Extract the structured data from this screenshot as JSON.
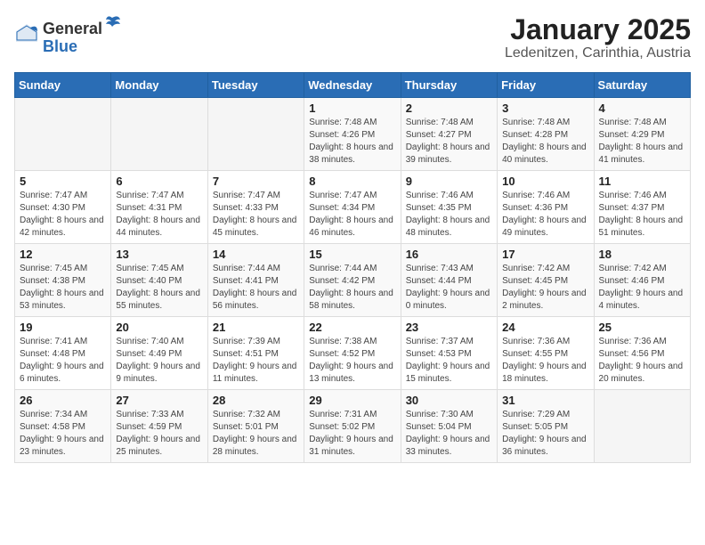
{
  "logo": {
    "general": "General",
    "blue": "Blue"
  },
  "header": {
    "month": "January 2025",
    "location": "Ledenitzen, Carinthia, Austria"
  },
  "weekdays": [
    "Sunday",
    "Monday",
    "Tuesday",
    "Wednesday",
    "Thursday",
    "Friday",
    "Saturday"
  ],
  "weeks": [
    [
      {
        "day": "",
        "info": ""
      },
      {
        "day": "",
        "info": ""
      },
      {
        "day": "",
        "info": ""
      },
      {
        "day": "1",
        "info": "Sunrise: 7:48 AM\nSunset: 4:26 PM\nDaylight: 8 hours and 38 minutes."
      },
      {
        "day": "2",
        "info": "Sunrise: 7:48 AM\nSunset: 4:27 PM\nDaylight: 8 hours and 39 minutes."
      },
      {
        "day": "3",
        "info": "Sunrise: 7:48 AM\nSunset: 4:28 PM\nDaylight: 8 hours and 40 minutes."
      },
      {
        "day": "4",
        "info": "Sunrise: 7:48 AM\nSunset: 4:29 PM\nDaylight: 8 hours and 41 minutes."
      }
    ],
    [
      {
        "day": "5",
        "info": "Sunrise: 7:47 AM\nSunset: 4:30 PM\nDaylight: 8 hours and 42 minutes."
      },
      {
        "day": "6",
        "info": "Sunrise: 7:47 AM\nSunset: 4:31 PM\nDaylight: 8 hours and 44 minutes."
      },
      {
        "day": "7",
        "info": "Sunrise: 7:47 AM\nSunset: 4:33 PM\nDaylight: 8 hours and 45 minutes."
      },
      {
        "day": "8",
        "info": "Sunrise: 7:47 AM\nSunset: 4:34 PM\nDaylight: 8 hours and 46 minutes."
      },
      {
        "day": "9",
        "info": "Sunrise: 7:46 AM\nSunset: 4:35 PM\nDaylight: 8 hours and 48 minutes."
      },
      {
        "day": "10",
        "info": "Sunrise: 7:46 AM\nSunset: 4:36 PM\nDaylight: 8 hours and 49 minutes."
      },
      {
        "day": "11",
        "info": "Sunrise: 7:46 AM\nSunset: 4:37 PM\nDaylight: 8 hours and 51 minutes."
      }
    ],
    [
      {
        "day": "12",
        "info": "Sunrise: 7:45 AM\nSunset: 4:38 PM\nDaylight: 8 hours and 53 minutes."
      },
      {
        "day": "13",
        "info": "Sunrise: 7:45 AM\nSunset: 4:40 PM\nDaylight: 8 hours and 55 minutes."
      },
      {
        "day": "14",
        "info": "Sunrise: 7:44 AM\nSunset: 4:41 PM\nDaylight: 8 hours and 56 minutes."
      },
      {
        "day": "15",
        "info": "Sunrise: 7:44 AM\nSunset: 4:42 PM\nDaylight: 8 hours and 58 minutes."
      },
      {
        "day": "16",
        "info": "Sunrise: 7:43 AM\nSunset: 4:44 PM\nDaylight: 9 hours and 0 minutes."
      },
      {
        "day": "17",
        "info": "Sunrise: 7:42 AM\nSunset: 4:45 PM\nDaylight: 9 hours and 2 minutes."
      },
      {
        "day": "18",
        "info": "Sunrise: 7:42 AM\nSunset: 4:46 PM\nDaylight: 9 hours and 4 minutes."
      }
    ],
    [
      {
        "day": "19",
        "info": "Sunrise: 7:41 AM\nSunset: 4:48 PM\nDaylight: 9 hours and 6 minutes."
      },
      {
        "day": "20",
        "info": "Sunrise: 7:40 AM\nSunset: 4:49 PM\nDaylight: 9 hours and 9 minutes."
      },
      {
        "day": "21",
        "info": "Sunrise: 7:39 AM\nSunset: 4:51 PM\nDaylight: 9 hours and 11 minutes."
      },
      {
        "day": "22",
        "info": "Sunrise: 7:38 AM\nSunset: 4:52 PM\nDaylight: 9 hours and 13 minutes."
      },
      {
        "day": "23",
        "info": "Sunrise: 7:37 AM\nSunset: 4:53 PM\nDaylight: 9 hours and 15 minutes."
      },
      {
        "day": "24",
        "info": "Sunrise: 7:36 AM\nSunset: 4:55 PM\nDaylight: 9 hours and 18 minutes."
      },
      {
        "day": "25",
        "info": "Sunrise: 7:36 AM\nSunset: 4:56 PM\nDaylight: 9 hours and 20 minutes."
      }
    ],
    [
      {
        "day": "26",
        "info": "Sunrise: 7:34 AM\nSunset: 4:58 PM\nDaylight: 9 hours and 23 minutes."
      },
      {
        "day": "27",
        "info": "Sunrise: 7:33 AM\nSunset: 4:59 PM\nDaylight: 9 hours and 25 minutes."
      },
      {
        "day": "28",
        "info": "Sunrise: 7:32 AM\nSunset: 5:01 PM\nDaylight: 9 hours and 28 minutes."
      },
      {
        "day": "29",
        "info": "Sunrise: 7:31 AM\nSunset: 5:02 PM\nDaylight: 9 hours and 31 minutes."
      },
      {
        "day": "30",
        "info": "Sunrise: 7:30 AM\nSunset: 5:04 PM\nDaylight: 9 hours and 33 minutes."
      },
      {
        "day": "31",
        "info": "Sunrise: 7:29 AM\nSunset: 5:05 PM\nDaylight: 9 hours and 36 minutes."
      },
      {
        "day": "",
        "info": ""
      }
    ]
  ]
}
